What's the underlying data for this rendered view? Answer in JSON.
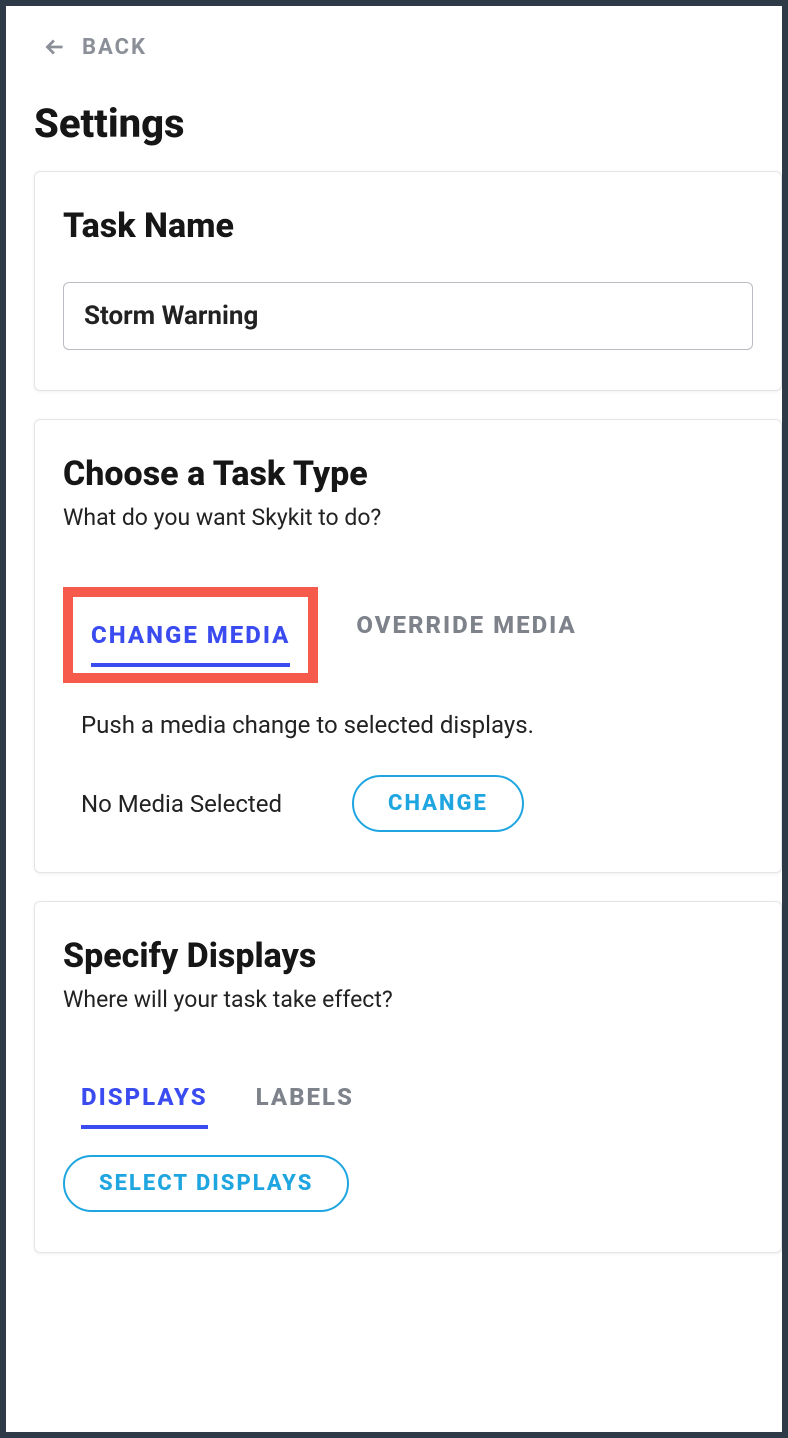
{
  "nav": {
    "back_label": "BACK"
  },
  "page": {
    "title": "Settings"
  },
  "task_name": {
    "heading": "Task Name",
    "value": "Storm Warning"
  },
  "task_type": {
    "heading": "Choose a Task Type",
    "subheading": "What do you want Skykit to do?",
    "tabs": {
      "change_media": "CHANGE MEDIA",
      "override_media": "OVERRIDE MEDIA"
    },
    "description": "Push a media change to selected displays.",
    "media_status": "No Media Selected",
    "change_button": "CHANGE"
  },
  "displays": {
    "heading": "Specify Displays",
    "subheading": "Where will your task take effect?",
    "tabs": {
      "displays": "DISPLAYS",
      "labels": "LABELS"
    },
    "select_button": "SELECT DISPLAYS"
  }
}
